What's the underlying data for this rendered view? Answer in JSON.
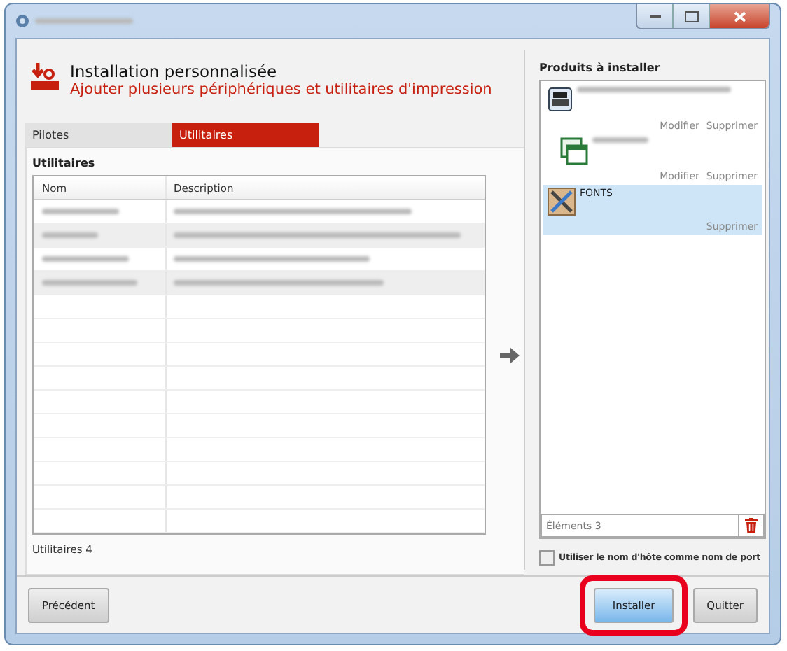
{
  "header": {
    "title": "Installation personnalisée",
    "subtitle": "Ajouter plusieurs périphériques et utilitaires d'impression"
  },
  "tabs": [
    {
      "label": "Pilotes",
      "selected": false
    },
    {
      "label": "Utilitaires",
      "selected": true
    }
  ],
  "utilities": {
    "heading": "Utilitaires",
    "columns": [
      "Nom",
      "Description"
    ],
    "rows": [
      {
        "kind": "redacted"
      },
      {
        "kind": "redacted"
      },
      {
        "kind": "redacted"
      },
      {
        "kind": "redacted"
      }
    ],
    "count": "Utilitaires 4"
  },
  "products": {
    "heading": "Produits à installer",
    "items": [
      {
        "kind": "printer",
        "actions": [
          "Modifier",
          "Supprimer"
        ],
        "selected": false
      },
      {
        "kind": "window",
        "actions": [
          "Modifier",
          "Supprimer"
        ],
        "selected": false
      },
      {
        "kind": "tools",
        "name": "FONTS",
        "actions": [
          "Supprimer"
        ],
        "selected": true
      }
    ],
    "count": "Éléments 3"
  },
  "hostname_option": {
    "label": "Utiliser le nom d'hôte comme nom de port",
    "checked": false
  },
  "buttons": {
    "back": "Précédent",
    "install": "Installer",
    "quit": "Quitter",
    "install_highlighted": true
  }
}
